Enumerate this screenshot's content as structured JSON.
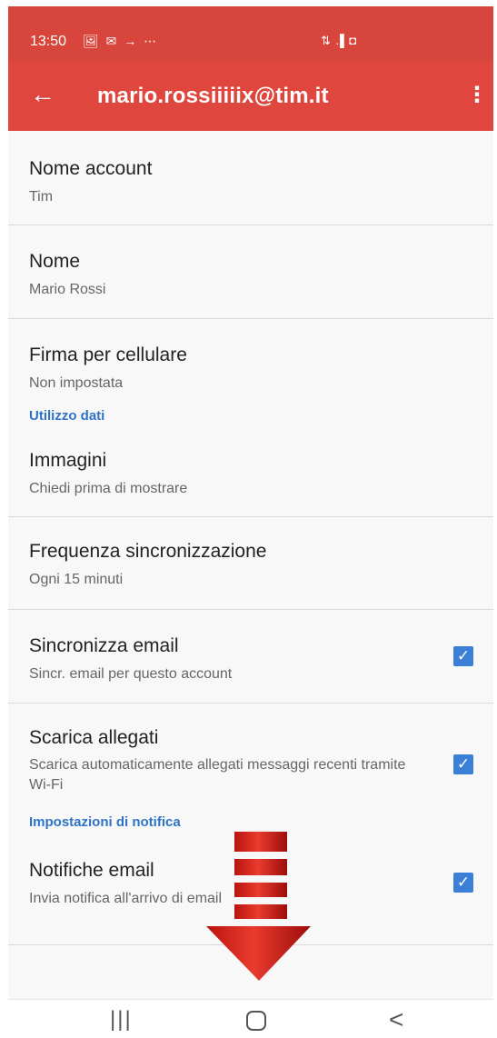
{
  "status_bar": {
    "time": "13:50",
    "left_icons": "🖼 ✉ → ⋯",
    "right_icons": "⇅ .▌◘"
  },
  "app_bar": {
    "title": "mario.rossiiiiix@tim.it",
    "back_icon": "←",
    "more_icon": "⋮"
  },
  "settings": {
    "account_name": {
      "title": "Nome account",
      "value": "Tim"
    },
    "name": {
      "title": "Nome",
      "value": "Mario Rossi"
    },
    "signature": {
      "title": "Firma per cellulare",
      "value": "Non impostata"
    },
    "data_usage_header": "Utilizzo dati",
    "images": {
      "title": "Immagini",
      "value": "Chiedi prima di mostrare"
    },
    "sync_frequency": {
      "title": "Frequenza sincronizzazione",
      "value": "Ogni 15 minuti"
    },
    "sync_email": {
      "title": "Sincronizza email",
      "value": "Sincr. email per questo account",
      "checked": true
    },
    "download_attachments": {
      "title": "Scarica allegati",
      "value": "Scarica automaticamente allegati messaggi recenti tramite Wi-Fi",
      "checked": true
    },
    "notifications_header": "Impostazioni di notifica",
    "email_notifications": {
      "title": "Notifiche email",
      "value": "Invia notifica all'arrivo di email",
      "checked": true
    }
  },
  "checkbox_glyph": "✓",
  "nav_bar": {
    "recents_icon": "|||",
    "back_icon": "<"
  },
  "colors": {
    "app_bar": "#de463e",
    "status_bar": "#d8453c",
    "accent": "#2f73c8",
    "checkbox": "#3c7fd6",
    "arrow_red": "#d6261f"
  }
}
